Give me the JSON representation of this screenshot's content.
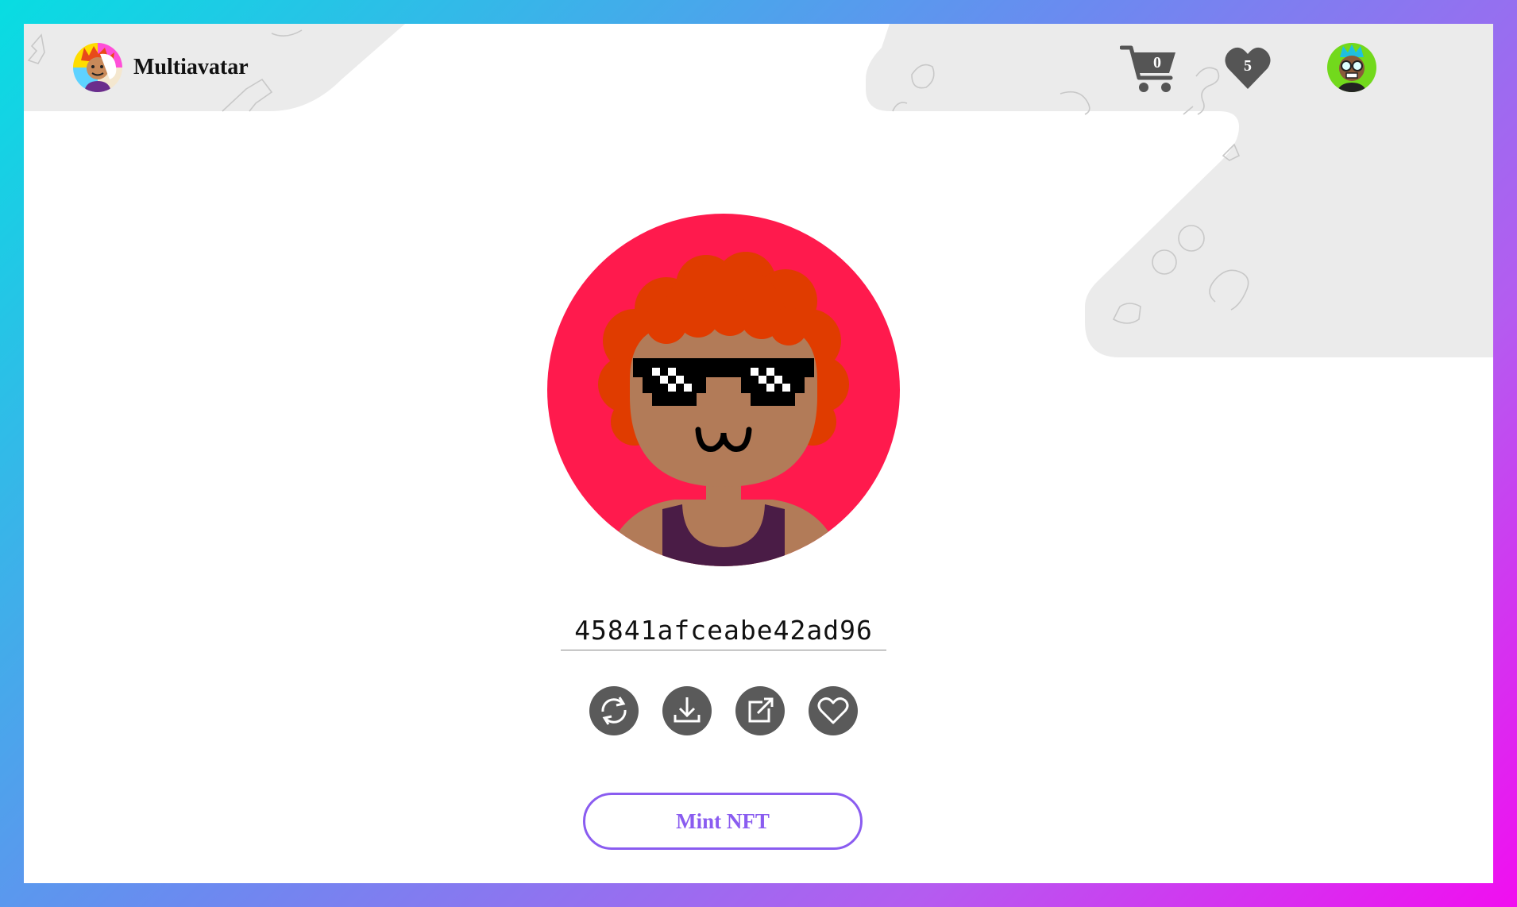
{
  "app": {
    "title": "Multiavatar"
  },
  "header": {
    "cart_count": "0",
    "favorites_count": "5"
  },
  "avatar": {
    "id_value": "45841afceabe42ad96",
    "colors": {
      "background": "#ff1a4d",
      "hair": "#e03c00",
      "skin": "#b27b58",
      "shirt": "#4a1c46"
    }
  },
  "actions": [
    {
      "name": "refresh",
      "icon": "refresh-icon"
    },
    {
      "name": "download",
      "icon": "download-icon"
    },
    {
      "name": "open",
      "icon": "external-link-icon"
    },
    {
      "name": "favorite",
      "icon": "heart-outline-icon"
    }
  ],
  "mint_button": {
    "label": "Mint NFT",
    "color": "#8a5cf0"
  },
  "theme": {
    "frame_gradient": [
      "#08dde2",
      "#6b8af0",
      "#b45cf0",
      "#f10ef0"
    ],
    "icon_gray": "#5a5a5a",
    "pattern_gray": "#ebebeb"
  }
}
